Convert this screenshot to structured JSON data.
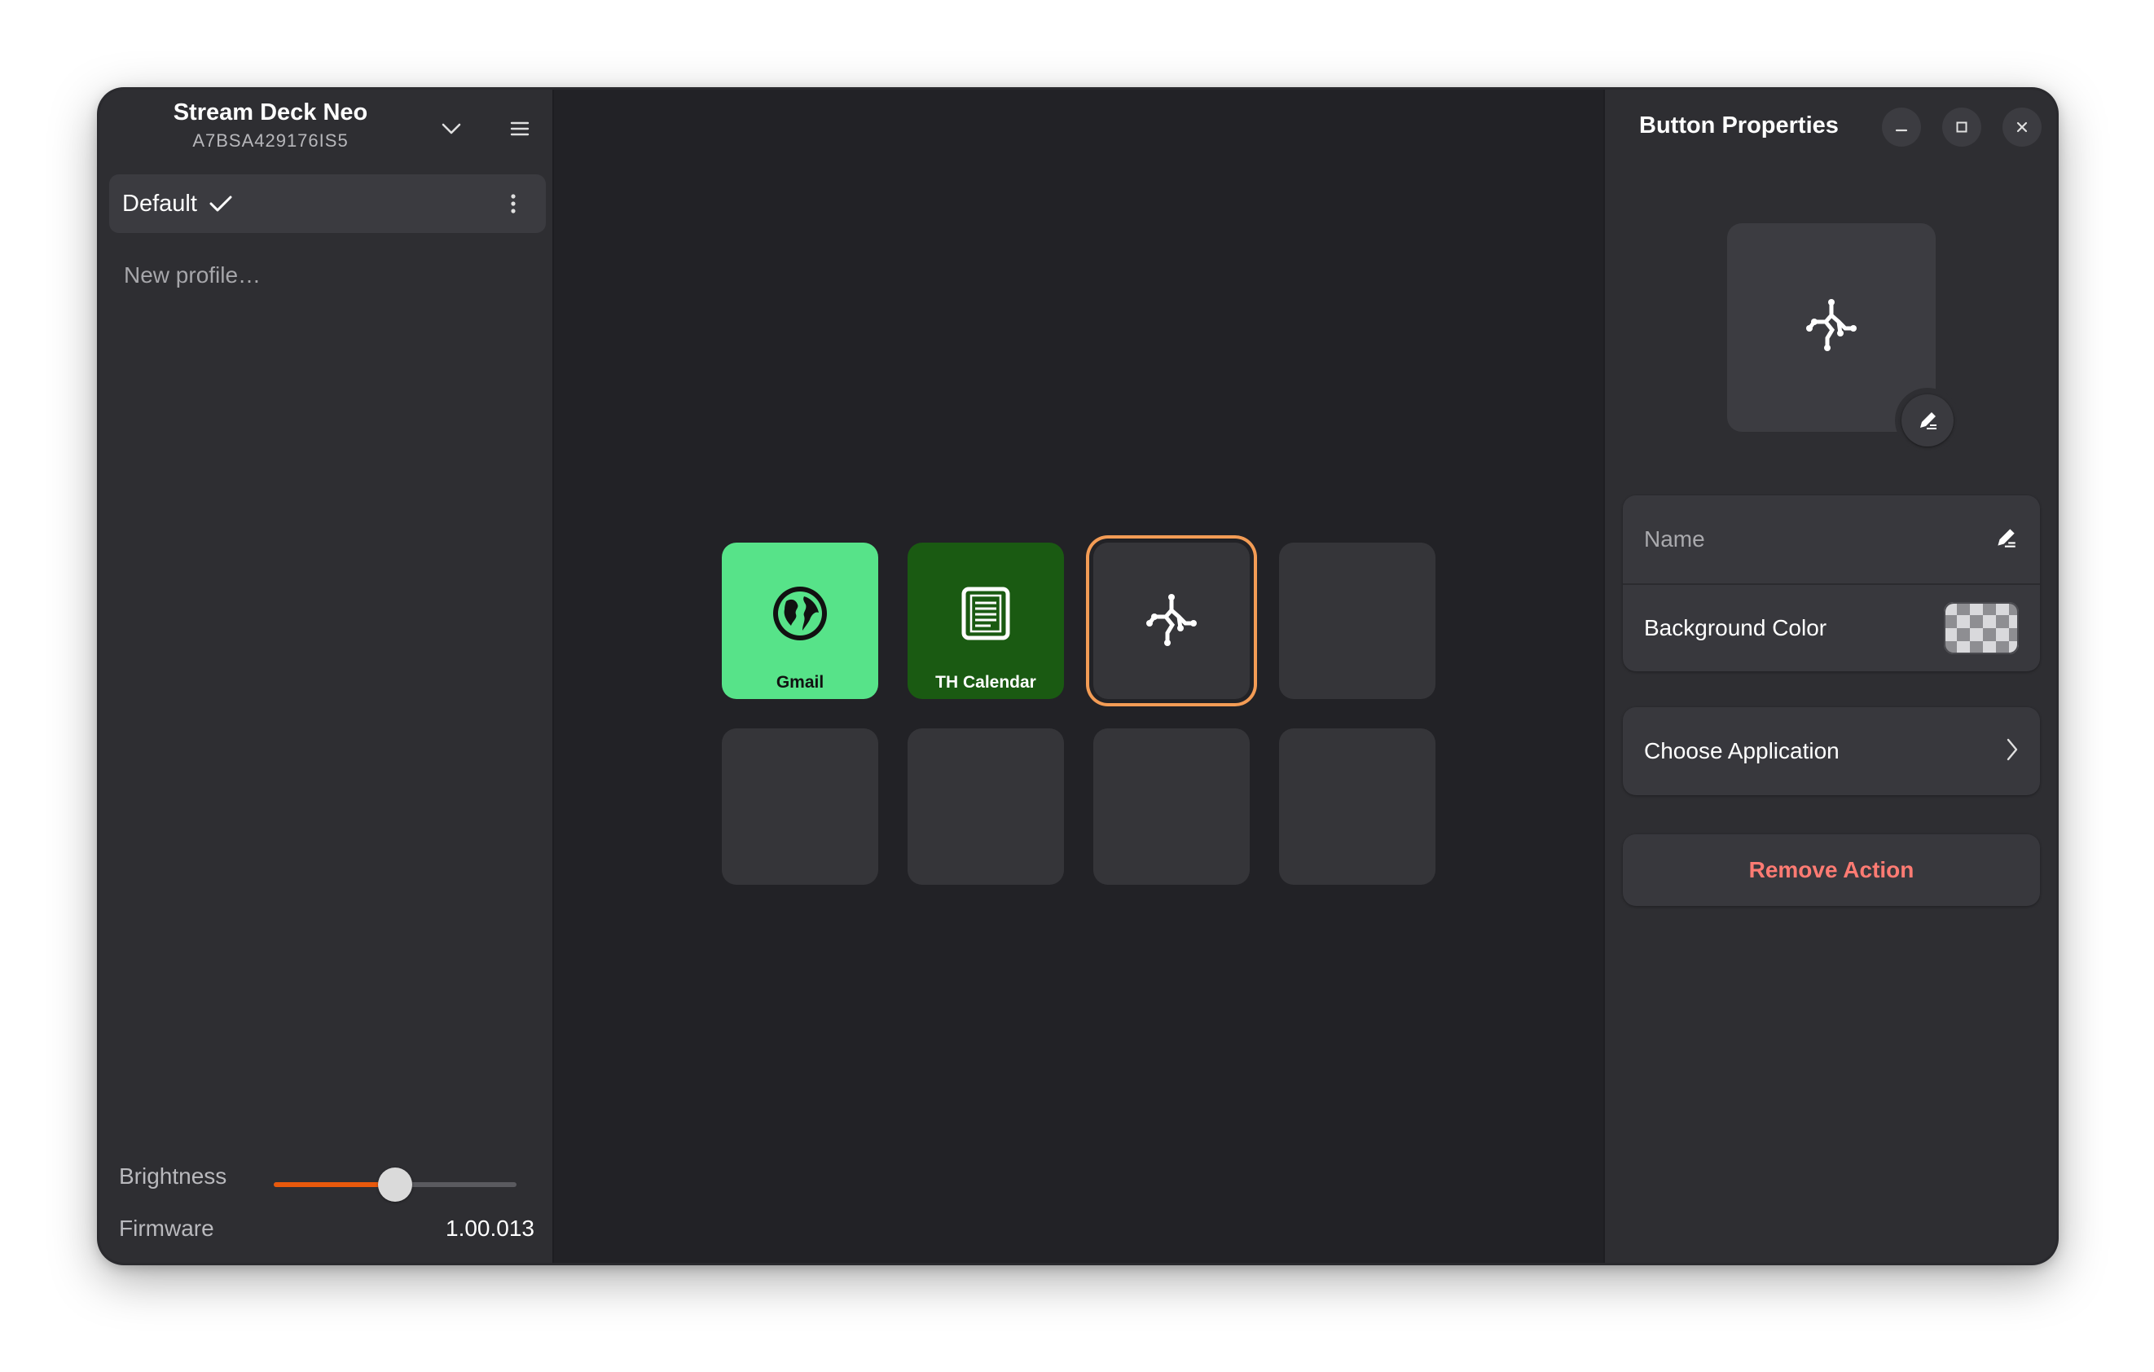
{
  "device": {
    "name": "Stream Deck Neo",
    "serial": "A7BSA429176IS5"
  },
  "profiles": {
    "active": "Default",
    "new_profile_label": "New profile…"
  },
  "settings": {
    "brightness_label": "Brightness",
    "brightness_level": 0.5,
    "firmware_label": "Firmware",
    "firmware_value": "1.00.013"
  },
  "keys": [
    {
      "label": "Gmail",
      "icon": "globe-icon",
      "color": "#57e389"
    },
    {
      "label": "TH Calendar",
      "icon": "calendar-icon",
      "color": "#1a5a12"
    },
    {
      "label": "",
      "icon": "action-icon",
      "selected": true
    },
    {
      "label": ""
    },
    {
      "label": ""
    },
    {
      "label": ""
    },
    {
      "label": ""
    },
    {
      "label": ""
    }
  ],
  "properties": {
    "title": "Button Properties",
    "name_placeholder": "Name",
    "background_color_label": "Background Color",
    "choose_application_label": "Choose Application",
    "remove_action_label": "Remove Action"
  },
  "colors": {
    "accent": "#e8590c",
    "selection": "#f39c55",
    "destructive": "#ff7b73"
  }
}
